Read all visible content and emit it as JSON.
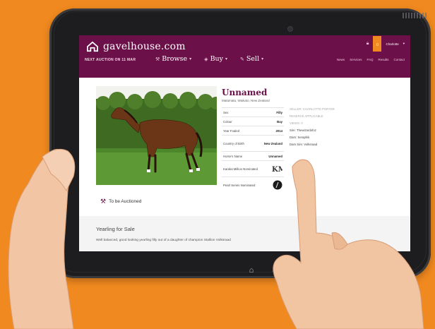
{
  "site": {
    "logo_text": "gavelhouse.com",
    "next_auction": "NEXT AUCTION ON 11 MAR",
    "user_name": "Charlotte",
    "bookmark_count": "0"
  },
  "menu": [
    {
      "label": "Browse",
      "icon": "gavel-icon"
    },
    {
      "label": "Buy",
      "icon": "tag-icon"
    },
    {
      "label": "Sell",
      "icon": "pencil-icon"
    }
  ],
  "right_links": [
    "News",
    "Services",
    "FAQ",
    "Results",
    "Contact"
  ],
  "listing": {
    "title": "Unnamed",
    "location": "Matamata, Waikato, New Zealand",
    "details": [
      {
        "label": "Sex",
        "value": "Filly"
      },
      {
        "label": "Colour",
        "value": "Bay"
      },
      {
        "label": "Year Foaled",
        "value": "2014"
      },
      {
        "label": "Country of Birth",
        "value": "New Zealand"
      },
      {
        "label": "Horse's Name",
        "value": "Unnamed"
      },
      {
        "label": "Karaka Million Nominated",
        "value": ""
      },
      {
        "label": "Pearl Series Nominated",
        "value": ""
      }
    ],
    "pedigree": [
      {
        "text": "SELLER: CHARLOTTE PORTER",
        "strong": false
      },
      {
        "text": "RESERVE APPLICABLE",
        "strong": false
      },
      {
        "text": "VIEWS: 0",
        "strong": false
      },
      {
        "text": "Sire: Thewizardofoz",
        "strong": true
      },
      {
        "text": "Dam: Seraphik",
        "strong": true
      },
      {
        "text": "Dam Sire: Volksraad",
        "strong": true
      }
    ],
    "status": "To be Auctioned",
    "section_title": "Yearling for Sale",
    "description": "Well balanced, good looking yearling filly out of a daughter of champion Stallion Volksraad"
  },
  "colors": {
    "brand": "#6b1049",
    "accent": "#f0891f",
    "background": "#f0891f"
  }
}
